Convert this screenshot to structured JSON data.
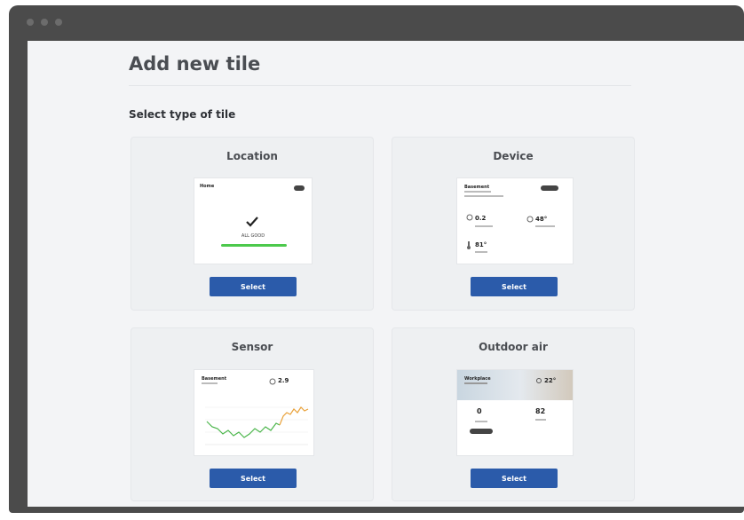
{
  "page": {
    "title": "Add new tile",
    "section_label": "Select type of tile"
  },
  "tiles": [
    {
      "title": "Location",
      "button": "Select",
      "preview": {
        "name": "Home",
        "status": "ALL GOOD",
        "status_color": "#4cc94c"
      }
    },
    {
      "title": "Device",
      "button": "Select",
      "preview": {
        "name": "Basement",
        "line1": "0.2",
        "line2": "48°",
        "line3": "81°"
      }
    },
    {
      "title": "Sensor",
      "button": "Select",
      "preview": {
        "name": "Basement",
        "value": "2.9",
        "line_colors": [
          "#4cb64c",
          "#e9a23b"
        ]
      }
    },
    {
      "title": "Outdoor air",
      "button": "Select",
      "preview": {
        "name": "Workplace",
        "temp": "22°",
        "value_a": "0",
        "value_b": "82"
      }
    }
  ],
  "colors": {
    "accent": "#2b5baa",
    "frame": "#4b4b4b",
    "background": "#f3f4f6"
  }
}
